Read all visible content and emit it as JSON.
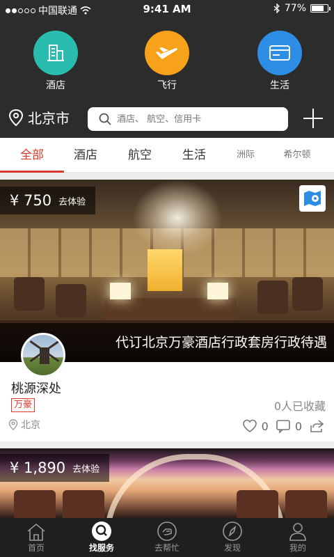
{
  "status_bar": {
    "carrier": "中国联通",
    "time": "9:41 AM",
    "battery": "77%",
    "battery_level": 0.77,
    "signal_bars": 2
  },
  "top_nav": [
    {
      "label": "酒店",
      "icon": "hotel-building-icon",
      "color": "#2bbcb0"
    },
    {
      "label": "飞行",
      "icon": "airplane-icon",
      "color": "#f7a21a"
    },
    {
      "label": "生活",
      "icon": "card-icon",
      "color": "#2e8ee6"
    }
  ],
  "search": {
    "city": "北京市",
    "placeholder": "酒店、 航空、信用卡"
  },
  "tabs": [
    {
      "label": "全部"
    },
    {
      "label": "酒店"
    },
    {
      "label": "航空"
    },
    {
      "label": "生活"
    },
    {
      "label": "洲际"
    },
    {
      "label": "希尔顿"
    }
  ],
  "cards": [
    {
      "price": "¥ 750",
      "price_action": "去体验",
      "caption": "代订北京万豪酒店行政套房行政待遇",
      "shop_name": "桃源深处",
      "tag": "万豪",
      "favorites": "0人已收藏",
      "location": "北京",
      "likes": "0",
      "comments": "0"
    },
    {
      "price": "¥ 1,890",
      "price_action": "去体验"
    }
  ],
  "tab_bar": [
    {
      "label": "首页",
      "icon": "home-icon"
    },
    {
      "label": "找服务",
      "icon": "search-service-icon"
    },
    {
      "label": "去帮忙",
      "icon": "help-hand-icon"
    },
    {
      "label": "发现",
      "icon": "compass-icon"
    },
    {
      "label": "我的",
      "icon": "profile-icon"
    }
  ],
  "colors": {
    "accent": "#d93a2b",
    "header_bg": "#2c2c2c",
    "tabbar_bg": "#1f1f1f"
  }
}
